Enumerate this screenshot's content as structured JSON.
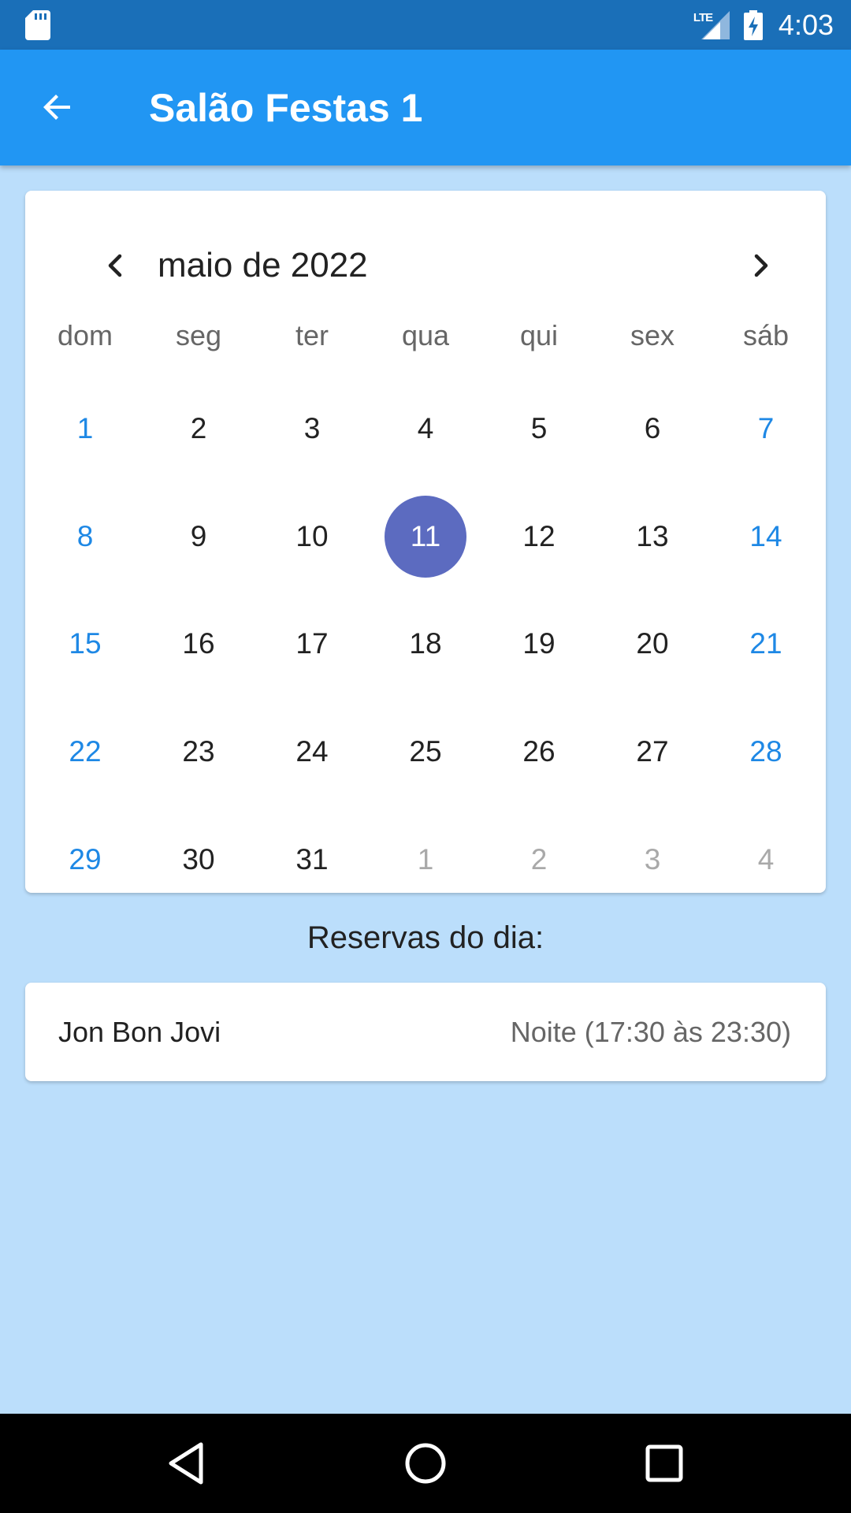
{
  "status_bar": {
    "time": "4:03",
    "network": "LTE",
    "icons": [
      "sd-card-icon",
      "lte-signal-icon",
      "battery-charging-icon"
    ]
  },
  "app_bar": {
    "title": "Salão Festas 1",
    "back_icon": "arrow-back-icon"
  },
  "calendar": {
    "month_label": "maio de 2022",
    "weekdays": [
      "dom",
      "seg",
      "ter",
      "qua",
      "qui",
      "sex",
      "sáb"
    ],
    "days": [
      {
        "label": "1",
        "kind": "weekend"
      },
      {
        "label": "2",
        "kind": "normal"
      },
      {
        "label": "3",
        "kind": "normal"
      },
      {
        "label": "4",
        "kind": "normal"
      },
      {
        "label": "5",
        "kind": "normal"
      },
      {
        "label": "6",
        "kind": "normal"
      },
      {
        "label": "7",
        "kind": "weekend"
      },
      {
        "label": "8",
        "kind": "weekend"
      },
      {
        "label": "9",
        "kind": "normal"
      },
      {
        "label": "10",
        "kind": "normal"
      },
      {
        "label": "11",
        "kind": "selected"
      },
      {
        "label": "12",
        "kind": "normal"
      },
      {
        "label": "13",
        "kind": "normal"
      },
      {
        "label": "14",
        "kind": "weekend"
      },
      {
        "label": "15",
        "kind": "weekend"
      },
      {
        "label": "16",
        "kind": "normal"
      },
      {
        "label": "17",
        "kind": "normal"
      },
      {
        "label": "18",
        "kind": "normal"
      },
      {
        "label": "19",
        "kind": "normal"
      },
      {
        "label": "20",
        "kind": "normal"
      },
      {
        "label": "21",
        "kind": "weekend"
      },
      {
        "label": "22",
        "kind": "weekend"
      },
      {
        "label": "23",
        "kind": "normal"
      },
      {
        "label": "24",
        "kind": "normal"
      },
      {
        "label": "25",
        "kind": "normal"
      },
      {
        "label": "26",
        "kind": "normal"
      },
      {
        "label": "27",
        "kind": "normal"
      },
      {
        "label": "28",
        "kind": "weekend"
      },
      {
        "label": "29",
        "kind": "weekend"
      },
      {
        "label": "30",
        "kind": "normal"
      },
      {
        "label": "31",
        "kind": "normal"
      },
      {
        "label": "1",
        "kind": "other"
      },
      {
        "label": "2",
        "kind": "other"
      },
      {
        "label": "3",
        "kind": "other"
      },
      {
        "label": "4",
        "kind": "other"
      }
    ],
    "colors": {
      "weekend": "#1e88e5",
      "selected_bg": "#5c6bc0",
      "outside_month": "#a9a9a9"
    }
  },
  "reservations": {
    "title": "Reservas do dia:",
    "items": [
      {
        "name": "Jon Bon Jovi",
        "period": "Noite (17:30 às 23:30)"
      }
    ]
  },
  "nav_bar": {
    "icons": [
      "nav-back-icon",
      "nav-home-icon",
      "nav-recents-icon"
    ]
  },
  "colors": {
    "status_bar": "#1a6fb8",
    "app_bar": "#2196f3",
    "background": "#bbdefb"
  }
}
